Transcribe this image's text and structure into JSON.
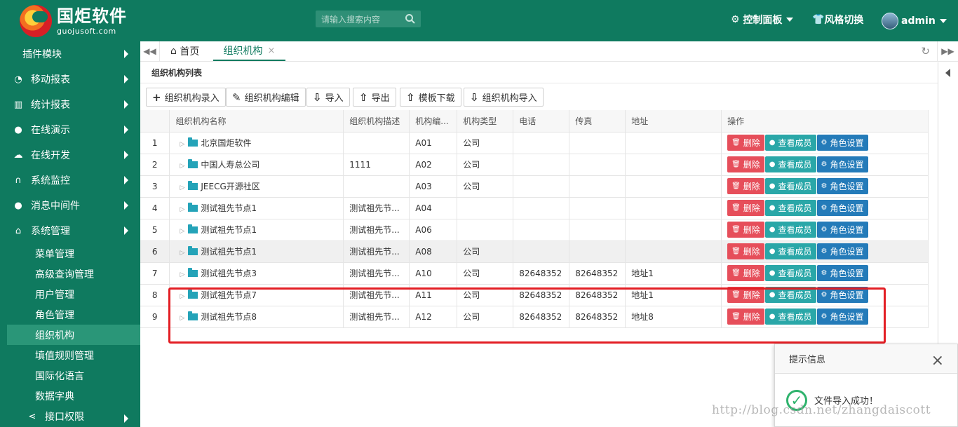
{
  "brand": {
    "title": "国炬软件",
    "subtitle": "guojusoft.com"
  },
  "header": {
    "search_placeholder": "请输入搜索内容",
    "control_panel": "控制面板",
    "theme_switch": "风格切换",
    "user": "admin"
  },
  "sidebar": {
    "items": [
      {
        "label": "插件模块",
        "icon": "plugin-icon"
      },
      {
        "label": "移动报表",
        "icon": "mobile-report-icon"
      },
      {
        "label": "统计报表",
        "icon": "bar-chart-icon"
      },
      {
        "label": "在线演示",
        "icon": "play-icon"
      },
      {
        "label": "在线开发",
        "icon": "cloud-icon"
      },
      {
        "label": "系统监控",
        "icon": "headset-icon"
      },
      {
        "label": "消息中间件",
        "icon": "comment-icon"
      },
      {
        "label": "系统管理",
        "icon": "home-icon"
      }
    ],
    "subitems": [
      "菜单管理",
      "高级查询管理",
      "用户管理",
      "角色管理",
      "组织机构",
      "填值规则管理",
      "国际化语言",
      "数据字典"
    ],
    "bottom": "接口权限"
  },
  "tabs": {
    "home": "首页",
    "current": "组织机构"
  },
  "panel": {
    "title": "组织机构列表"
  },
  "toolbar": [
    "组织机构录入",
    "组织机构编辑",
    "导入",
    "导出",
    "模板下载",
    "组织机构导入"
  ],
  "table": {
    "headers": [
      "",
      "组织机构名称",
      "组织机构描述",
      "机构编...",
      "机构类型",
      "电话",
      "传真",
      "地址",
      "操作"
    ],
    "rows": [
      [
        "1",
        "北京国炬软件",
        "",
        "A01",
        "公司",
        "",
        "",
        ""
      ],
      [
        "2",
        "中国人寿总公司",
        "1111",
        "A02",
        "公司",
        "",
        "",
        ""
      ],
      [
        "3",
        "JEECG开源社区",
        "",
        "A03",
        "公司",
        "",
        "",
        ""
      ],
      [
        "4",
        "测试祖先节点1",
        "测试祖先节...",
        "A04",
        "",
        "",
        "",
        ""
      ],
      [
        "5",
        "测试祖先节点1",
        "测试祖先节...",
        "A06",
        "",
        "",
        "",
        ""
      ],
      [
        "6",
        "测试祖先节点1",
        "测试祖先节...",
        "A08",
        "公司",
        "",
        "",
        ""
      ],
      [
        "7",
        "测试祖先节点3",
        "测试祖先节...",
        "A10",
        "公司",
        "82648352",
        "82648352",
        "地址1"
      ],
      [
        "8",
        "测试祖先节点7",
        "测试祖先节...",
        "A11",
        "公司",
        "82648352",
        "82648352",
        "地址1"
      ],
      [
        "9",
        "测试祖先节点8",
        "测试祖先节...",
        "A12",
        "公司",
        "82648352",
        "82648352",
        "地址8"
      ]
    ],
    "actions": [
      "删除",
      "查看成员",
      "角色设置"
    ]
  },
  "toast": {
    "title": "提示信息",
    "message": "文件导入成功！"
  },
  "watermark": "http://blog.csdn.net/zhangdaiscott",
  "colors": {
    "header": "#0f7a5f",
    "danger": "#e64e5a",
    "view": "#2aa7a8",
    "role": "#247bb9"
  }
}
